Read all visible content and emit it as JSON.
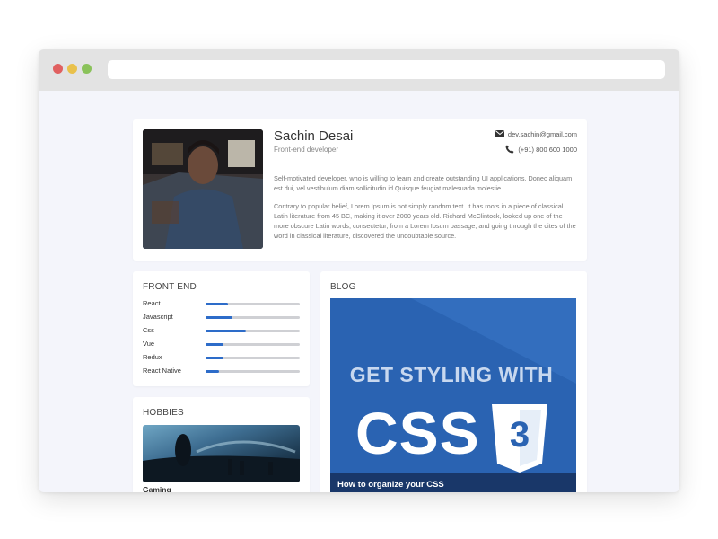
{
  "profile": {
    "name": "Sachin Desai",
    "role": "Front-end developer",
    "email": "dev.sachin@gmail.com",
    "phone": "(+91) 800 600 1000",
    "bio1": "Self-motivated developer, who is willing to learn and create outstanding UI applications. Donec aliquam est dui, vel vestibulum diam sollicitudin id.Quisque feugiat malesuada molestie.",
    "bio2": "Contrary to popular belief, Lorem Ipsum is not simply random text. It has roots in a piece of classical Latin literature from 45 BC, making it over 2000 years old. Richard McClintock, looked up one of the more obscure Latin words, consectetur, from a Lorem Ipsum passage, and going through the cites of the word in classical literature, discovered the undoubtable source."
  },
  "skills": {
    "title": "FRONT END",
    "items": [
      {
        "label": "React",
        "level": 0.24
      },
      {
        "label": "Javascript",
        "level": 0.29
      },
      {
        "label": "Css",
        "level": 0.43
      },
      {
        "label": "Vue",
        "level": 0.19
      },
      {
        "label": "Redux",
        "level": 0.19
      },
      {
        "label": "React Native",
        "level": 0.14
      }
    ]
  },
  "hobbies": {
    "title": "HOBBIES",
    "item_label": "Gaming"
  },
  "blog": {
    "title": "BLOG",
    "headline": "GET STYLING WITH",
    "big_text": "CSS",
    "badge_number": "3",
    "caption": "How to organize your CSS"
  },
  "colors": {
    "accent": "#2d6cc9",
    "window_bg": "#f4f5fb",
    "titlebar": "#e3e3e3"
  }
}
